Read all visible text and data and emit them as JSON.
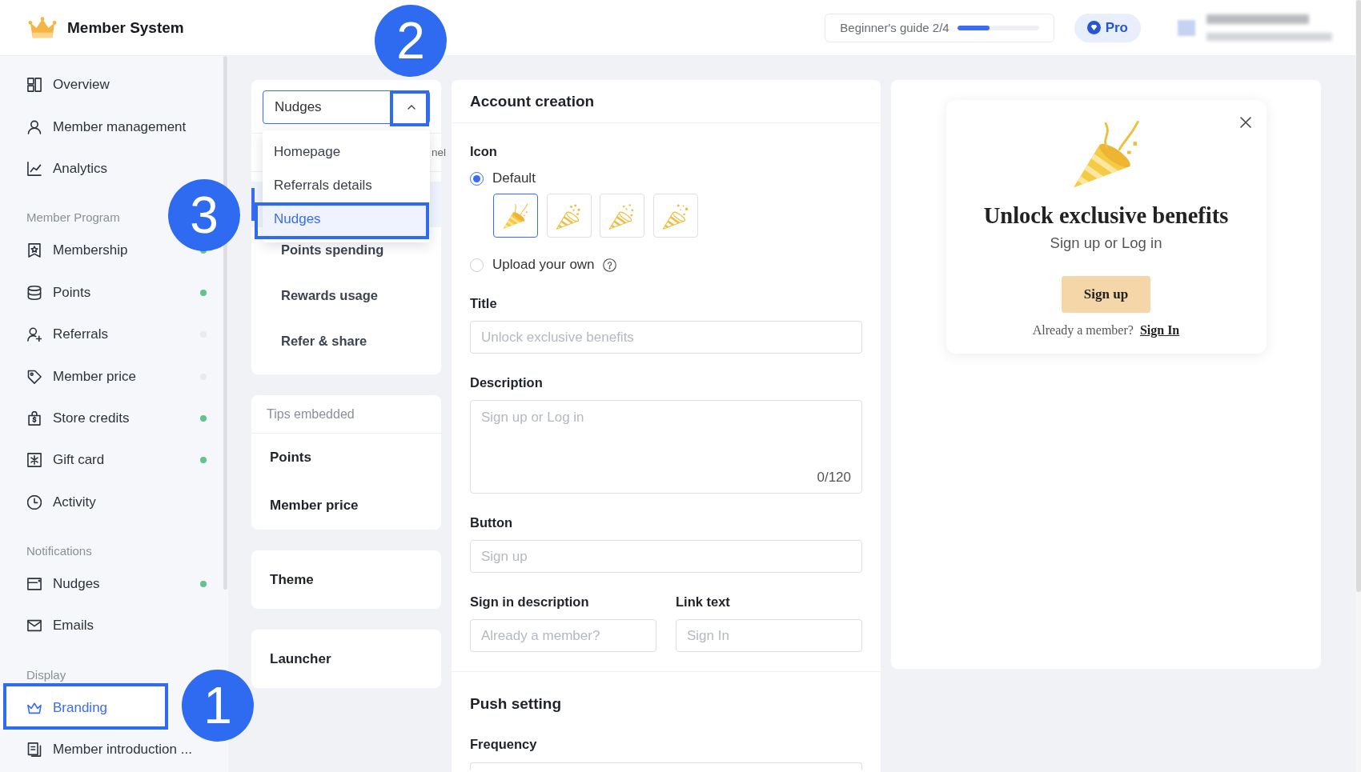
{
  "top_bar": {
    "app_name": "Member System",
    "guide": {
      "label": "Beginner's guide 2/4",
      "level": 0.4
    },
    "plan": "Pro"
  },
  "sidebar": {
    "groups": [
      {
        "items": [
          {
            "label": "Overview",
            "selected": false,
            "highlighted": false
          },
          {
            "label": "Member management",
            "selected": false,
            "highlighted": false
          },
          {
            "label": "Analytics",
            "selected": false,
            "highlighted": false
          }
        ]
      },
      {
        "heading": "Member Program",
        "items": [
          {
            "label": "Membership",
            "selected": false,
            "highlighted": false,
            "color": "#63c38f"
          },
          {
            "label": "Points",
            "selected": false,
            "highlighted": false,
            "color": "#63c38f"
          },
          {
            "label": "Referrals",
            "selected": false,
            "highlighted": false,
            "color": "#e9eaee"
          },
          {
            "label": "Member price",
            "selected": false,
            "highlighted": false,
            "color": "#e9eaee"
          },
          {
            "label": "Store credits",
            "selected": false,
            "highlighted": false,
            "color": "#63c38f"
          },
          {
            "label": "Gift card",
            "selected": false,
            "highlighted": false,
            "color": "#63c38f"
          },
          {
            "label": "Activity",
            "selected": false,
            "highlighted": false
          }
        ]
      },
      {
        "heading": "Notifications",
        "items": [
          {
            "label": "Nudges",
            "selected": false,
            "highlighted": false,
            "color": "#63c38f"
          },
          {
            "label": "Emails",
            "selected": false,
            "highlighted": false
          }
        ]
      },
      {
        "heading": "Display",
        "items": [
          {
            "label": "Branding",
            "selected": true,
            "highlighted": true,
            "callout": "1"
          },
          {
            "label": "Member introduction ...",
            "selected": false,
            "highlighted": false
          }
        ]
      }
    ]
  },
  "page_picker": {
    "select": {
      "value": "Nudges",
      "expanded": true,
      "highlighted": true,
      "callout": "2"
    },
    "options": [
      {
        "label": "Homepage",
        "selected": false,
        "highlighted": false
      },
      {
        "label": "Referrals details",
        "selected": false,
        "highlighted": false
      },
      {
        "label": "Nudges",
        "selected": true,
        "highlighted": true,
        "callout": "3"
      }
    ],
    "tab_fragment": "nel",
    "sections": [
      {
        "selected": true
      },
      {
        "label": "Points spending",
        "selected": false
      },
      {
        "label": "Rewards usage",
        "selected": false
      },
      {
        "label": "Refer & share",
        "selected": false
      }
    ]
  },
  "tips_embedded": {
    "heading": "Tips embedded",
    "items": [
      {
        "label": "Points"
      },
      {
        "label": "Member price"
      }
    ]
  },
  "nav_cards": [
    {
      "label": "Theme"
    },
    {
      "label": "Launcher"
    }
  ],
  "form": {
    "title": "Account creation",
    "icon_setting": {
      "label": "Icon",
      "choices": [
        {
          "kind": "presets",
          "label": "Default",
          "selected": true
        },
        {
          "kind": "upload",
          "label": "Upload your own",
          "selected": false
        }
      ],
      "presets": [
        {
          "selected": true
        },
        {
          "selected": false
        },
        {
          "selected": false
        },
        {
          "selected": false
        }
      ]
    },
    "fields": [
      {
        "kind": "input",
        "label": "Title",
        "placeholder": "Unlock exclusive benefits"
      },
      {
        "kind": "textarea",
        "label": "Description",
        "placeholder": "Sign up or Log in",
        "counter": "0/120"
      },
      {
        "kind": "input",
        "label": "Button",
        "placeholder": "Sign up"
      },
      {
        "kind": "pair",
        "items": [
          {
            "label": "Sign in description",
            "placeholder": "Already a member?"
          },
          {
            "label": "Link text",
            "placeholder": "Sign In"
          }
        ]
      }
    ]
  },
  "push_setting": {
    "title": "Push setting",
    "fields": [
      {
        "label": "Frequency"
      }
    ]
  },
  "preview": {
    "title": "Unlock exclusive benefits",
    "subtitle": "Sign up or Log in",
    "button": "Sign up",
    "signin_prompt": "Already a member?",
    "signin_link": "Sign In"
  }
}
